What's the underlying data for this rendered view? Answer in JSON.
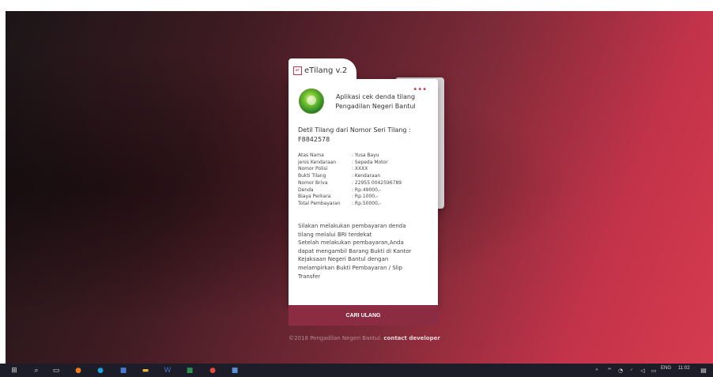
{
  "app": {
    "tab_title": "eTilang v.2",
    "subtitle_line1": "Aplikasi cek denda tilang",
    "subtitle_line2": "Pengadilan Negeri Bantul",
    "more_label": "•••"
  },
  "detail": {
    "heading": "Detil Tilang dari Nomor Seri Tilang :",
    "serial": "F8842578",
    "rows": [
      {
        "label": "Atas Nama",
        "value": ": Yusa Bayu"
      },
      {
        "label": "jenis Kendaraan",
        "value": ": Sepeda Motor"
      },
      {
        "label": "Nomor Polisi",
        "value": ": XXXX"
      },
      {
        "label": "Bukti Tilang",
        "value": ": Kendaraan"
      },
      {
        "label": "Nomor Briva",
        "value": ": 22955 0042596789"
      },
      {
        "label": "Denda",
        "value": ": Rp.49000,-"
      },
      {
        "label": "Biaya Perkara",
        "value": ": Rp.1000,-"
      },
      {
        "label": "Total Pembayaran",
        "value": ": Rp.50000,-"
      }
    ]
  },
  "message": {
    "line1": "Silakan melakukan pembayaran denda",
    "line2": "tilang melalui BRI terdekat",
    "line3": "Setelah melakukan pembayaran,Anda",
    "line4": "dapat mengambil Barang Bukti di Kantor",
    "line5": "Kejaksaan Negeri Bantul dengan",
    "line6": "melampirkan Bukti Pembayaran / Slip",
    "line7": "Transfer"
  },
  "button": {
    "label": "CARI ULANG"
  },
  "footer": {
    "copyright": "©2018 Pengadilan Negeri Bantul.",
    "contact": "contact developer"
  },
  "taskbar": {
    "lang": "ENG",
    "time": "11:02",
    "icons": [
      "windows-start-icon",
      "search-icon",
      "task-view-icon",
      "firefox-icon",
      "edge-icon",
      "calculator-icon",
      "file-explorer-icon",
      "word-icon",
      "excel-icon",
      "chrome-icon",
      "app-icon"
    ]
  },
  "colors": {
    "accent": "#c2374d",
    "button": "#8b2c42"
  }
}
